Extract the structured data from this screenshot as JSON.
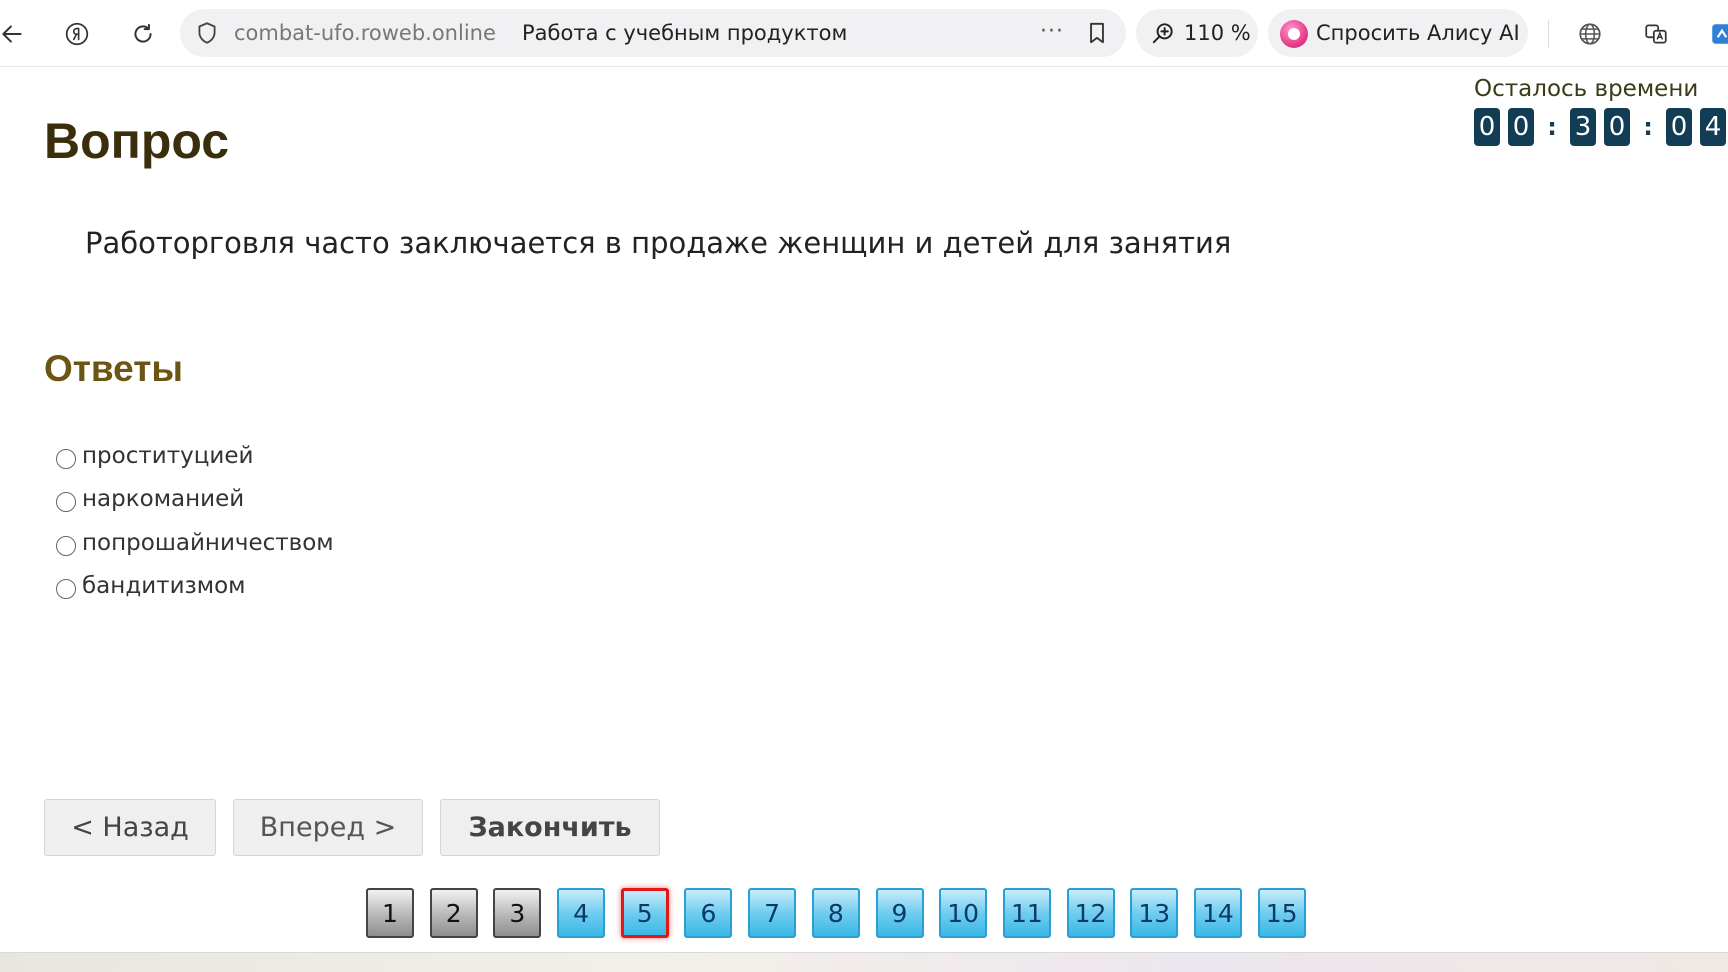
{
  "browser": {
    "address": {
      "domain": "combat-ufo.roweb.online",
      "page_title": "Работа с учебным продуктом",
      "more_glyph": "···"
    },
    "zoom": "110 %",
    "assistant_label": "Спросить Алису AI",
    "icons": [
      "back-arrow-icon",
      "yandex-logo-icon",
      "reload-icon",
      "shield-icon",
      "bookmark-icon",
      "zoom-icon",
      "alice-icon",
      "globe-icon",
      "translate-icon",
      "extension-icon"
    ]
  },
  "timer": {
    "label": "Осталось времени",
    "digits": [
      "0",
      "0",
      "3",
      "0",
      "0",
      "4"
    ],
    "separator": ":",
    "digit_color": "#123d55"
  },
  "question": {
    "heading": "Вопрос",
    "text": "Работорговля часто заключается в продаже женщин и детей для занятия"
  },
  "answers": {
    "heading": "Ответы",
    "options": [
      {
        "label": "проституцией",
        "selected": false
      },
      {
        "label": "наркоманией",
        "selected": false
      },
      {
        "label": "попрошайничеством",
        "selected": false
      },
      {
        "label": "бандитизмом",
        "selected": false
      }
    ]
  },
  "buttons": {
    "back": "< Назад",
    "forward": "Вперед >",
    "finish": "Закончить"
  },
  "pager": {
    "pages": [
      {
        "label": "1",
        "state": "answered"
      },
      {
        "label": "2",
        "state": "answered"
      },
      {
        "label": "3",
        "state": "answered"
      },
      {
        "label": "4",
        "state": "pending"
      },
      {
        "label": "5",
        "state": "current"
      },
      {
        "label": "6",
        "state": "pending"
      },
      {
        "label": "7",
        "state": "pending"
      },
      {
        "label": "8",
        "state": "pending"
      },
      {
        "label": "9",
        "state": "pending"
      },
      {
        "label": "10",
        "state": "pending"
      },
      {
        "label": "11",
        "state": "pending"
      },
      {
        "label": "12",
        "state": "pending"
      },
      {
        "label": "13",
        "state": "pending"
      },
      {
        "label": "14",
        "state": "pending"
      },
      {
        "label": "15",
        "state": "pending"
      }
    ],
    "colors": {
      "answered": "#9a9a9a",
      "pending": "#4fc0ea",
      "current_border": "#e01818"
    }
  }
}
